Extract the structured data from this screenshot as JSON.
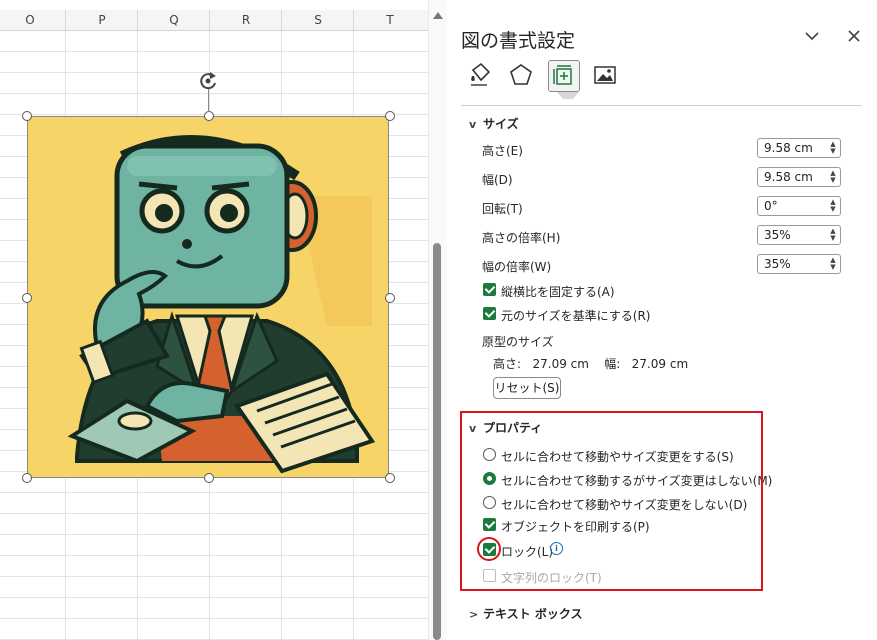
{
  "sheet": {
    "columns": [
      "O",
      "P",
      "Q",
      "R",
      "S",
      "T"
    ]
  },
  "pane": {
    "title": "図の書式設定",
    "tabs": [
      "fill-line-icon",
      "effects-icon",
      "size-properties-icon",
      "picture-icon"
    ],
    "size_section": {
      "header": "サイズ",
      "height_label": "高さ(E)",
      "height_value": "9.58 cm",
      "width_label": "幅(D)",
      "width_value": "9.58 cm",
      "rotation_label": "回転(T)",
      "rotation_value": "0°",
      "scale_height_label": "高さの倍率(H)",
      "scale_height_value": "35%",
      "scale_width_label": "幅の倍率(W)",
      "scale_width_value": "35%",
      "lock_aspect_label": "縦横比を固定する(A)",
      "relative_original_label": "元のサイズを基準にする(R)",
      "original_size_label": "原型のサイズ",
      "original_size_text": "高さ:   27.09 cm    幅:   27.09 cm",
      "reset_label": "リセット(S)"
    },
    "properties_section": {
      "header": "プロパティ",
      "radio_1": "セルに合わせて移動やサイズ変更をする(S)",
      "radio_2": "セルに合わせて移動するがサイズ変更はしない(M)",
      "radio_3": "セルに合わせて移動やサイズ変更をしない(D)",
      "print_label": "オブジェクトを印刷する(P)",
      "lock_label": "ロック(L)",
      "lock_text_label": "文字列のロック(T)"
    },
    "textbox_section": {
      "header": "テキスト ボックス"
    }
  },
  "colors": {
    "accent_green": "#1b7a3e",
    "highlight_red": "#d9141c",
    "picture_bg": "#f6d468"
  }
}
